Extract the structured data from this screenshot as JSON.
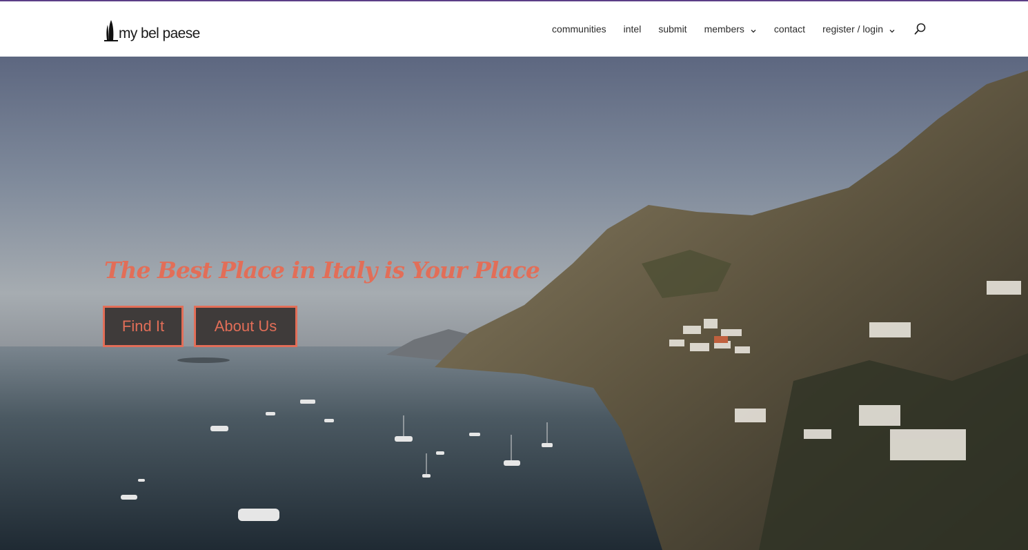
{
  "brand": {
    "logo_text": "my bel paese",
    "accent_color": "#5b3e86"
  },
  "nav": {
    "items": [
      {
        "label": "communities",
        "has_dropdown": false
      },
      {
        "label": "intel",
        "has_dropdown": false
      },
      {
        "label": "submit",
        "has_dropdown": false
      },
      {
        "label": "members",
        "has_dropdown": true
      },
      {
        "label": "contact",
        "has_dropdown": false
      },
      {
        "label": "register / login",
        "has_dropdown": true
      }
    ],
    "search_icon": "search-icon"
  },
  "hero": {
    "headline": "The Best Place in Italy is Your Place",
    "headline_color": "#e26e58",
    "buttons": {
      "find_label": "Find It",
      "about_label": "About Us"
    },
    "button_bg": "#3f3b3a",
    "image": "coastal-village-photo"
  }
}
